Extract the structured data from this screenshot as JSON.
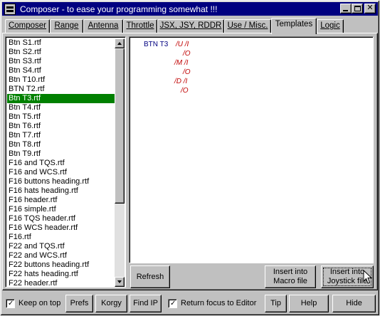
{
  "window": {
    "title": "Composer - to ease your programming somewhat !!!",
    "minimize_glyph": "_",
    "maximize_glyph": "□",
    "close_glyph": "✕"
  },
  "tabs": [
    {
      "label": "Composer"
    },
    {
      "label": "Range"
    },
    {
      "label": "Antenna"
    },
    {
      "label": "Throttle"
    },
    {
      "label": "JSX, JSY, RDDR"
    },
    {
      "label": "Use / Misc."
    },
    {
      "label": "Templates"
    },
    {
      "label": "Logic"
    }
  ],
  "active_tab": "Templates",
  "files": [
    "Btn S1.rtf",
    "Btn S2.rtf",
    "Btn S3.rtf",
    "Btn S4.rtf",
    "Btn T10.rtf",
    "BTN T2.rtf",
    "Btn T3.rtf",
    "Btn T4.rtf",
    "Btn T5.rtf",
    "Btn T6.rtf",
    "Btn T7.rtf",
    "Btn T8.rtf",
    "Btn T9.rtf",
    "F16 and TQS.rtf",
    "F16 and WCS.rtf",
    "F16 buttons heading.rtf",
    "F16 hats heading.rtf",
    "F16 header.rtf",
    "F16 simple.rtf",
    "F16 TQS header.rtf",
    "F16 WCS header.rtf",
    "F16.rtf",
    "F22 and TQS.rtf",
    "F22 and WCS.rtf",
    "F22 buttons heading.rtf",
    "F22 hats heading.rtf",
    "F22 header.rtf"
  ],
  "selected_file": "Btn T3.rtf",
  "editor": {
    "heading": "BTN T3",
    "lines": [
      "/U /I",
      "/O",
      "/M /I",
      "/O",
      "/D /I",
      "/O"
    ]
  },
  "buttons": {
    "refresh": "Refresh",
    "insert_macro": "Insert into\nMacro file",
    "insert_joystick": "Insert into\nJoystick file",
    "prefs": "Prefs",
    "korgy": "Korgy",
    "find_ip": "Find IP",
    "tip": "Tip",
    "help": "Help",
    "hide": "Hide"
  },
  "checkboxes": {
    "keep_on_top": {
      "label": "Keep on top",
      "checked": true
    },
    "return_focus": {
      "label": "Return focus to Editor",
      "checked": true
    }
  },
  "check_glyph": "✓",
  "colors": {
    "titlebar": "#000080",
    "selection": "#008000",
    "editor_heading": "#000080",
    "editor_text": "#c00000"
  }
}
